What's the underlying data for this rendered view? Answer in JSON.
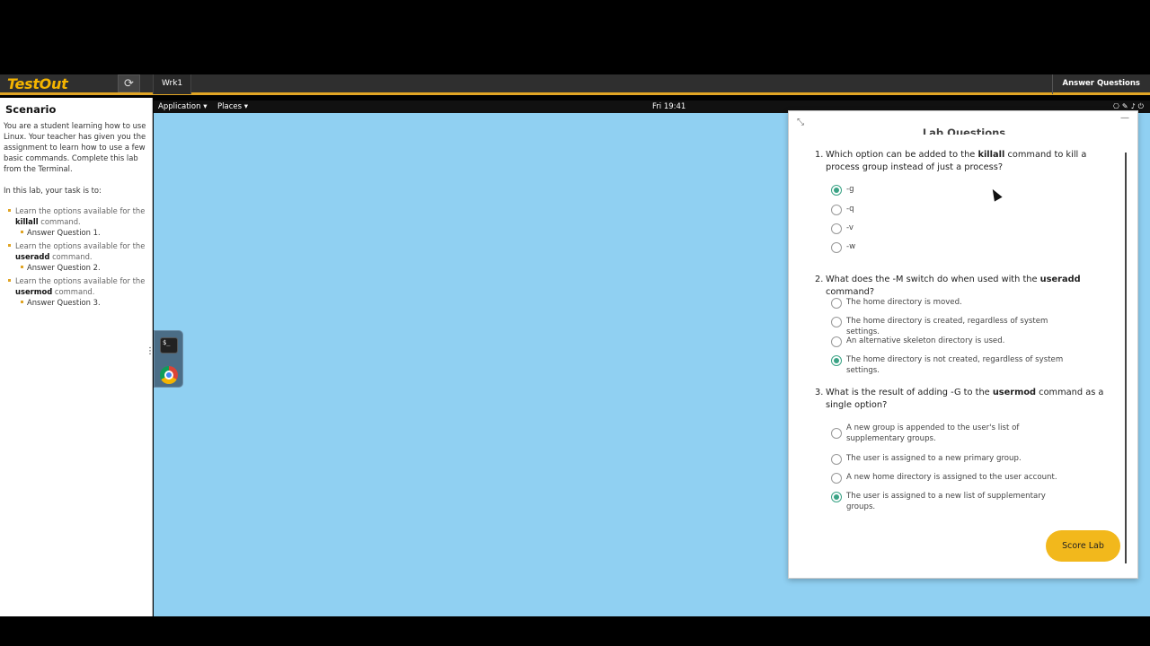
{
  "topbar": {
    "logo": "TestOut",
    "refresh_icon": "refresh-icon",
    "machine_tab": "Wrk1",
    "answer_button": "Answer Questions"
  },
  "scenario": {
    "title": "Scenario",
    "intro": "You are a student learning how to use Linux. Your teacher has given you the assignment to learn how to use a few basic commands. Complete this lab from the Terminal.",
    "task_intro": "In this lab, your task is to:",
    "tasks": [
      {
        "prefix": "Learn the options available for the",
        "command": "killall",
        "suffix": "command.",
        "sub": "Answer Question 1."
      },
      {
        "prefix": "Learn the options available for the",
        "command": "useradd",
        "suffix": "command.",
        "sub": "Answer Question 2."
      },
      {
        "prefix": "Learn the options available for the",
        "command": "usermod",
        "suffix": "command.",
        "sub": "Answer Question 3."
      }
    ]
  },
  "gnome": {
    "application_menu": "Application ▾",
    "places_menu": "Places ▾",
    "clock": "Fri 19:41",
    "icons": [
      "network-icon",
      "pen-icon",
      "volume-icon",
      "power-icon"
    ]
  },
  "dock": {
    "items": [
      "terminal-icon",
      "chrome-icon"
    ],
    "terminal_glyph": "$_"
  },
  "dialog": {
    "title": "Lab Questions",
    "questions": [
      {
        "number": "1.",
        "text_before": "Which option can be added to the ",
        "command": "killall",
        "text_after": " command to kill a process group instead of just a process?",
        "options": [
          "-g",
          "-q",
          "-v",
          "-w"
        ],
        "selected": 0
      },
      {
        "number": "2.",
        "text_before": "What does the -M switch do when used with the ",
        "command": "useradd",
        "text_after": " command?",
        "options": [
          "The home directory is moved.",
          "The home directory is created, regardless of system settings.",
          "An alternative skeleton directory is used.",
          "The home directory is not created, regardless of system settings."
        ],
        "selected": 3
      },
      {
        "number": "3.",
        "text_before": "What is the result of adding -G to the ",
        "command": "usermod",
        "text_after": " command as a single option?",
        "options": [
          "A new group is appended to the user's list of supplementary groups.",
          "The user is assigned to a new primary group.",
          "A new home directory is assigned to the user account.",
          "The user is assigned to a new list of supplementary groups."
        ],
        "selected": 3
      }
    ],
    "score_button": "Score Lab"
  },
  "colors": {
    "accent": "#f2b81c",
    "radio_checked": "#3aa385",
    "desktop": "#90d0f2"
  }
}
